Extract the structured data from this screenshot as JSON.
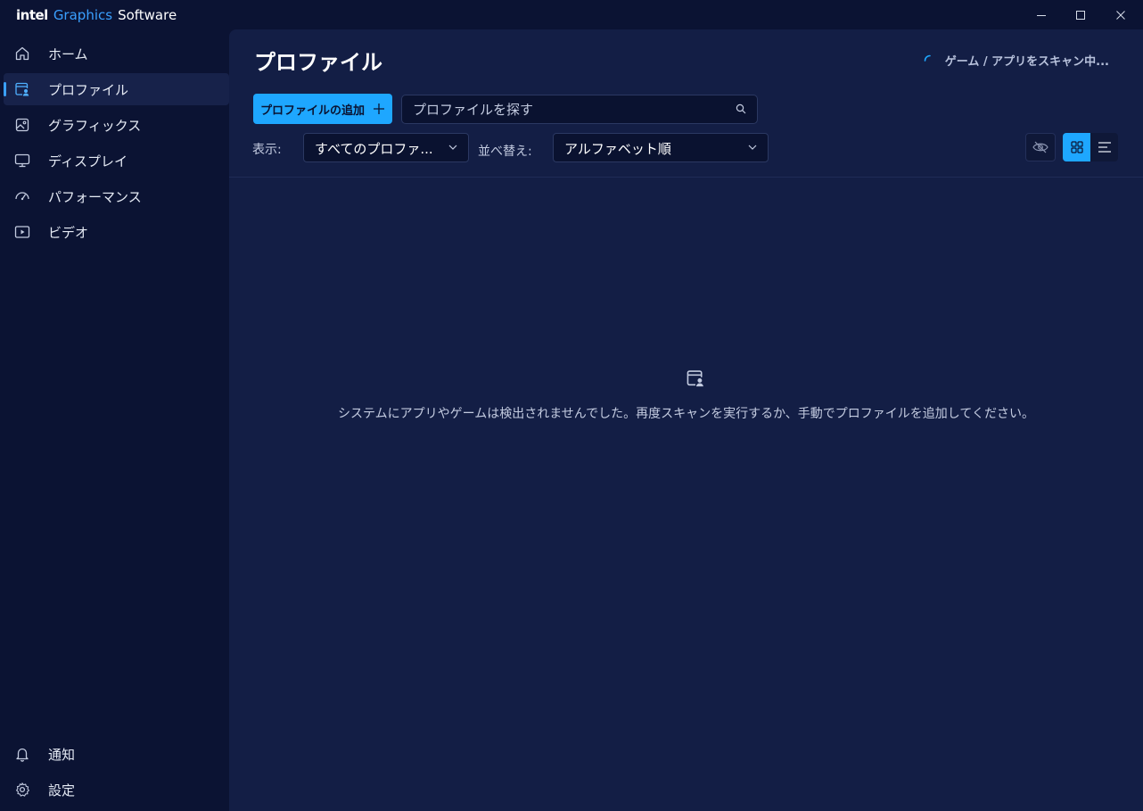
{
  "app": {
    "brand_intel": "intel",
    "brand_graphics": "Graphics",
    "brand_software": "Software"
  },
  "window": {
    "minimize_icon": "minimize-icon",
    "maximize_icon": "maximize-icon",
    "close_icon": "close-icon"
  },
  "sidebar": {
    "items": [
      {
        "label": "ホーム",
        "icon": "home-icon"
      },
      {
        "label": "プロファイル",
        "icon": "profile-icon",
        "active": true
      },
      {
        "label": "グラフィックス",
        "icon": "image-icon"
      },
      {
        "label": "ディスプレイ",
        "icon": "monitor-icon"
      },
      {
        "label": "パフォーマンス",
        "icon": "gauge-icon"
      },
      {
        "label": "ビデオ",
        "icon": "video-icon"
      }
    ],
    "bottom": [
      {
        "label": "通知",
        "icon": "bell-icon"
      },
      {
        "label": "設定",
        "icon": "gear-icon"
      }
    ]
  },
  "header": {
    "title": "プロファイル",
    "scan_status": "ゲーム / アプリをスキャン中..."
  },
  "toolbar": {
    "add_profile_label": "プロファイルの追加",
    "search_placeholder": "プロファイルを探す",
    "show_label": "表示:",
    "show_value": "すべてのプロファ...",
    "sort_label": "並べ替え:",
    "sort_value": "アルファベット順"
  },
  "empty_state": {
    "message": "システムにアプリやゲームは検出されませんでした。再度スキャンを実行するか、手動でプロファイルを追加してください。"
  },
  "colors": {
    "accent": "#1ea7ff",
    "background": "#0b1333",
    "panel": "#131e45"
  }
}
